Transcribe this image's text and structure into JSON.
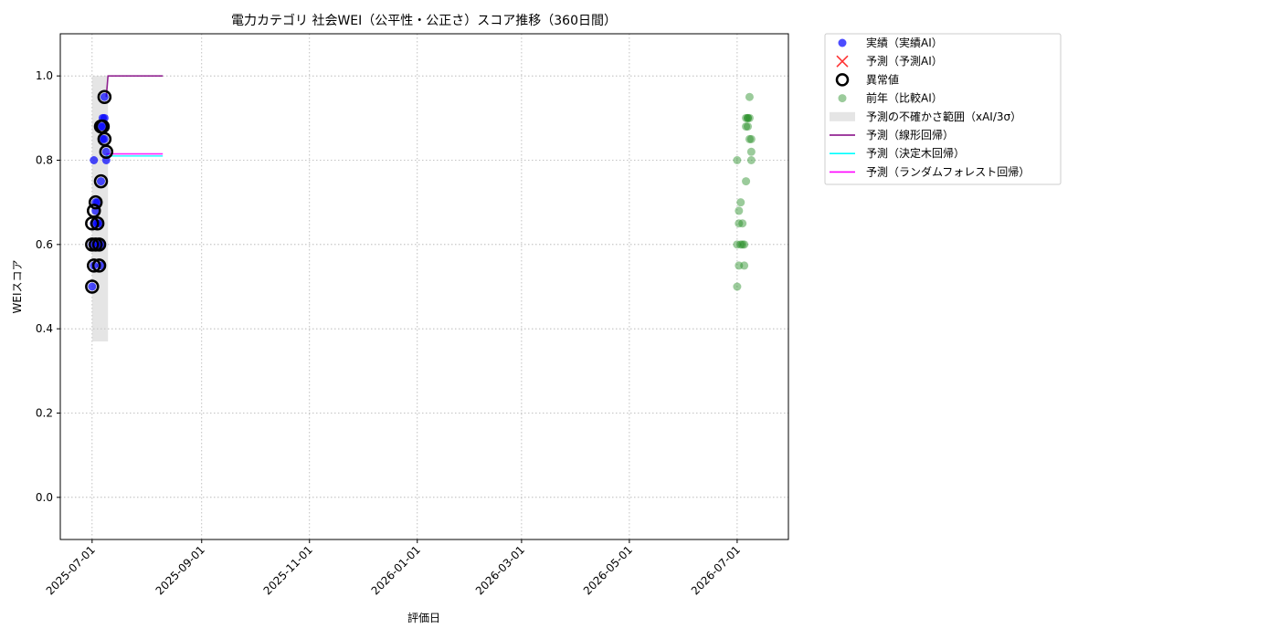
{
  "chart_data": {
    "type": "scatter",
    "title": "電力カテゴリ 社会WEI（公平性・公正さ）スコア推移（360日間）",
    "xlabel": "評価日",
    "ylabel": "WEIスコア",
    "xlim": [
      "2025-06-13",
      "2026-07-30"
    ],
    "ylim": [
      -0.1,
      1.1
    ],
    "x_ticks": [
      "2025-07-01",
      "2025-09-01",
      "2025-11-01",
      "2026-01-01",
      "2026-03-01",
      "2026-05-01",
      "2026-07-01"
    ],
    "y_ticks": [
      0.0,
      0.2,
      0.4,
      0.6,
      0.8,
      1.0
    ],
    "y_tick_labels": [
      "0.0",
      "0.2",
      "0.4",
      "0.6",
      "0.8",
      "1.0"
    ],
    "grid": true,
    "legend_position": "outside-top-right",
    "series": [
      {
        "name": "実績（実績AI）",
        "kind": "scatter",
        "color": "#0000ff",
        "points": [
          [
            "2025-07-01",
            0.5
          ],
          [
            "2025-07-01",
            0.6
          ],
          [
            "2025-07-02",
            0.8
          ],
          [
            "2025-07-02",
            0.65
          ],
          [
            "2025-07-02",
            0.55
          ],
          [
            "2025-07-03",
            0.6
          ],
          [
            "2025-07-03",
            0.68
          ],
          [
            "2025-07-03",
            0.7
          ],
          [
            "2025-07-04",
            0.7
          ],
          [
            "2025-07-04",
            0.65
          ],
          [
            "2025-07-05",
            0.6
          ],
          [
            "2025-07-05",
            0.65
          ],
          [
            "2025-07-06",
            0.55
          ],
          [
            "2025-07-06",
            0.6
          ],
          [
            "2025-07-06",
            0.75
          ],
          [
            "2025-07-06",
            0.88
          ],
          [
            "2025-07-07",
            0.9
          ],
          [
            "2025-07-07",
            0.88
          ],
          [
            "2025-07-07",
            0.85
          ],
          [
            "2025-07-08",
            0.9
          ],
          [
            "2025-07-08",
            0.85
          ],
          [
            "2025-07-08",
            0.95
          ],
          [
            "2025-07-09",
            0.82
          ],
          [
            "2025-07-09",
            0.8
          ]
        ]
      },
      {
        "name": "予測（予測AI）",
        "kind": "x-marker",
        "color": "#ff0000",
        "points": []
      },
      {
        "name": "異常値",
        "kind": "ring",
        "color": "#000000",
        "points": [
          [
            "2025-07-01",
            0.5
          ],
          [
            "2025-07-01",
            0.6
          ],
          [
            "2025-07-01",
            0.65
          ],
          [
            "2025-07-02",
            0.55
          ],
          [
            "2025-07-02",
            0.68
          ],
          [
            "2025-07-03",
            0.7
          ],
          [
            "2025-07-03",
            0.6
          ],
          [
            "2025-07-04",
            0.65
          ],
          [
            "2025-07-05",
            0.6
          ],
          [
            "2025-07-05",
            0.55
          ],
          [
            "2025-07-06",
            0.75
          ],
          [
            "2025-07-06",
            0.88
          ],
          [
            "2025-07-07",
            0.88
          ],
          [
            "2025-07-08",
            0.85
          ],
          [
            "2025-07-08",
            0.95
          ],
          [
            "2025-07-09",
            0.82
          ]
        ]
      },
      {
        "name": "前年（比較AI）",
        "kind": "scatter",
        "color": "#228b22",
        "points": [
          [
            "2026-07-01",
            0.5
          ],
          [
            "2026-07-01",
            0.6
          ],
          [
            "2026-07-01",
            0.8
          ],
          [
            "2026-07-02",
            0.55
          ],
          [
            "2026-07-02",
            0.65
          ],
          [
            "2026-07-02",
            0.68
          ],
          [
            "2026-07-03",
            0.7
          ],
          [
            "2026-07-03",
            0.6
          ],
          [
            "2026-07-04",
            0.65
          ],
          [
            "2026-07-04",
            0.6
          ],
          [
            "2026-07-05",
            0.55
          ],
          [
            "2026-07-05",
            0.6
          ],
          [
            "2026-07-06",
            0.75
          ],
          [
            "2026-07-06",
            0.88
          ],
          [
            "2026-07-06",
            0.9
          ],
          [
            "2026-07-07",
            0.9
          ],
          [
            "2026-07-07",
            0.88
          ],
          [
            "2026-07-07",
            0.9
          ],
          [
            "2026-07-08",
            0.95
          ],
          [
            "2026-07-08",
            0.85
          ],
          [
            "2026-07-08",
            0.9
          ],
          [
            "2026-07-09",
            0.8
          ],
          [
            "2026-07-09",
            0.85
          ],
          [
            "2026-07-09",
            0.82
          ]
        ]
      },
      {
        "name": "予測の不確かさ範囲（xAI/3σ）",
        "kind": "band",
        "color": "#cccccc",
        "x": [
          "2025-07-01",
          "2025-07-10"
        ],
        "lower": 0.37,
        "upper": 1.0
      },
      {
        "name": "予測（線形回帰）",
        "kind": "line",
        "color": "#800080",
        "points": [
          [
            "2025-07-09",
            0.95
          ],
          [
            "2025-07-10",
            1.0
          ],
          [
            "2025-08-10",
            1.0
          ]
        ]
      },
      {
        "name": "予測（決定木回帰）",
        "kind": "line",
        "color": "#00ffff",
        "points": [
          [
            "2025-07-09",
            0.81
          ],
          [
            "2025-08-10",
            0.81
          ]
        ]
      },
      {
        "name": "予測（ランダムフォレスト回帰）",
        "kind": "line",
        "color": "#ff00ff",
        "points": [
          [
            "2025-07-09",
            0.815
          ],
          [
            "2025-08-10",
            0.815
          ]
        ]
      }
    ]
  }
}
